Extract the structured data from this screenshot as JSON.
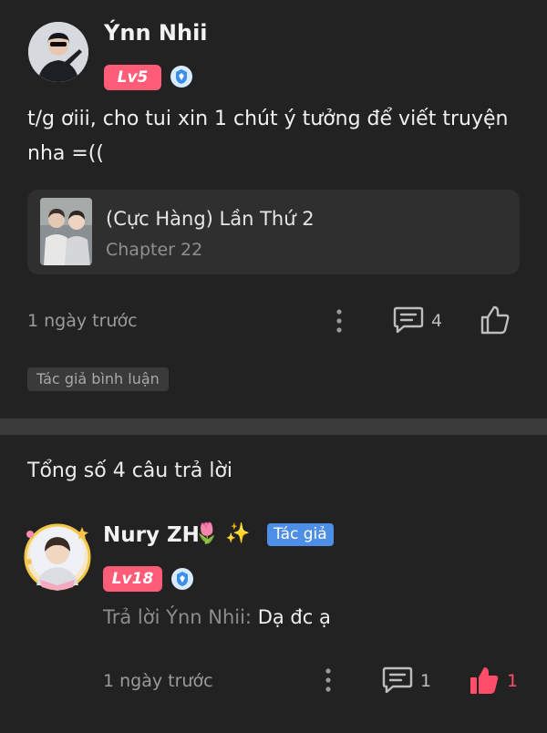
{
  "comment": {
    "username": "Ýnn Nhii",
    "level": "Lv5",
    "text": "t/g ơiii, cho tui xin 1 chút ý tưởng để viết truyện nha =((",
    "story": {
      "title": "(Cực Hàng) Lần Thứ 2",
      "chapter": "Chapter 22"
    },
    "time": "1 ngày trước",
    "reply_count": "4",
    "author_comment_tag": "Tác giả bình luận"
  },
  "replies": {
    "total_label": "Tổng số 4 câu trả lời",
    "items": [
      {
        "username": "Nury ZH",
        "emojis": "🌷 ✨",
        "author_tag": "Tác giả",
        "level": "Lv18",
        "reply_prefix": "Trả lời Ýnn Nhii:",
        "text": "Dạ đc ạ",
        "time": "1 ngày trước",
        "reply_count": "1",
        "like_count": "1"
      }
    ]
  },
  "colors": {
    "background": "#222222",
    "level_badge": "#ff5c77",
    "author_tag": "#4d8fe6",
    "liked": "#ff4d6a",
    "divider": "#3b3b3b"
  },
  "icons": [
    "verified-shield-icon",
    "more-vert-icon",
    "comment-icon",
    "thumb-up-outline-icon",
    "thumb-up-filled-icon"
  ]
}
